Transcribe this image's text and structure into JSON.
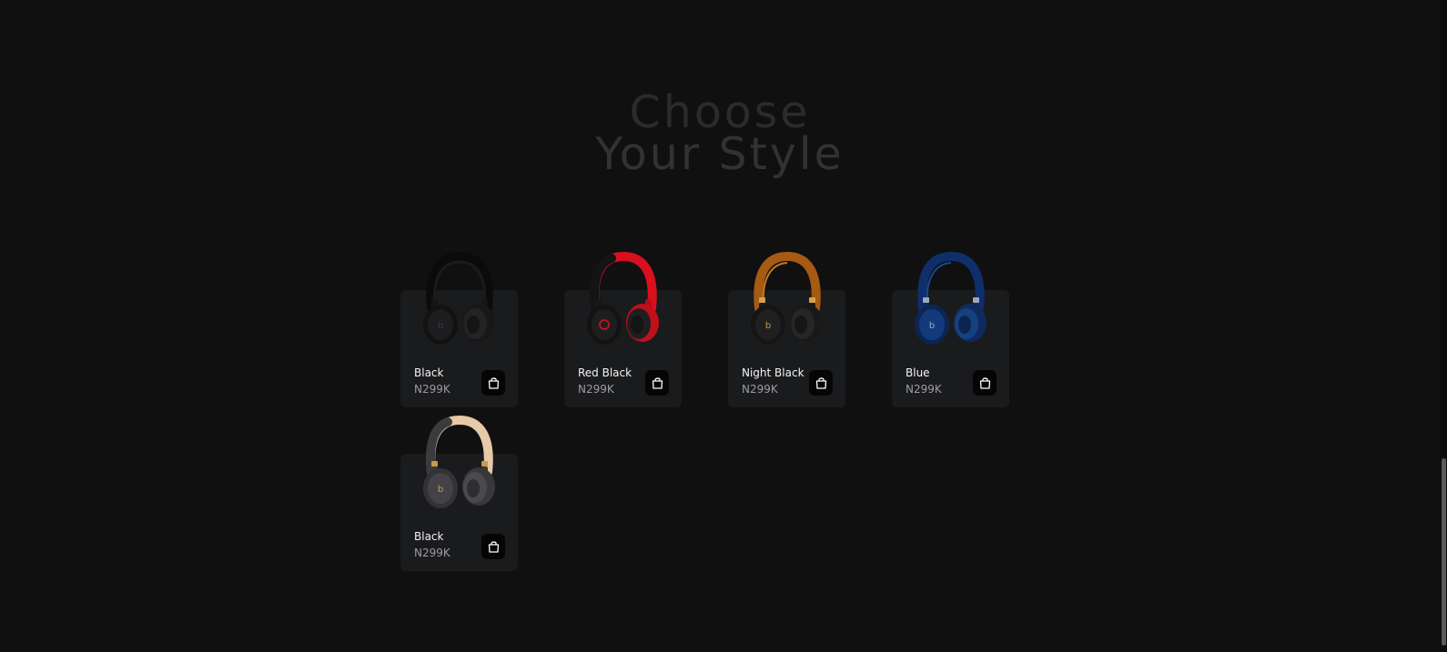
{
  "section": {
    "title_line1": "Choose",
    "title_line2": "Your Style"
  },
  "products": [
    {
      "name": "Black",
      "price": "N299K",
      "color": "black",
      "icon": "shopping-bag-icon"
    },
    {
      "name": "Red Black",
      "price": "N299K",
      "color": "red-black",
      "icon": "shopping-bag-icon"
    },
    {
      "name": "Night Black",
      "price": "N299K",
      "color": "night-black",
      "icon": "shopping-bag-icon"
    },
    {
      "name": "Blue",
      "price": "N299K",
      "color": "blue",
      "icon": "shopping-bag-icon"
    },
    {
      "name": "Black",
      "price": "N299K",
      "color": "black-gold",
      "icon": "shopping-bag-icon"
    }
  ],
  "colors": {
    "background": "#101011",
    "card": "#1a1b1d",
    "title": "#2b2b2e",
    "product_name": "#f4f4f4",
    "price": "#9c9ca1",
    "cart_button": "#050506"
  }
}
